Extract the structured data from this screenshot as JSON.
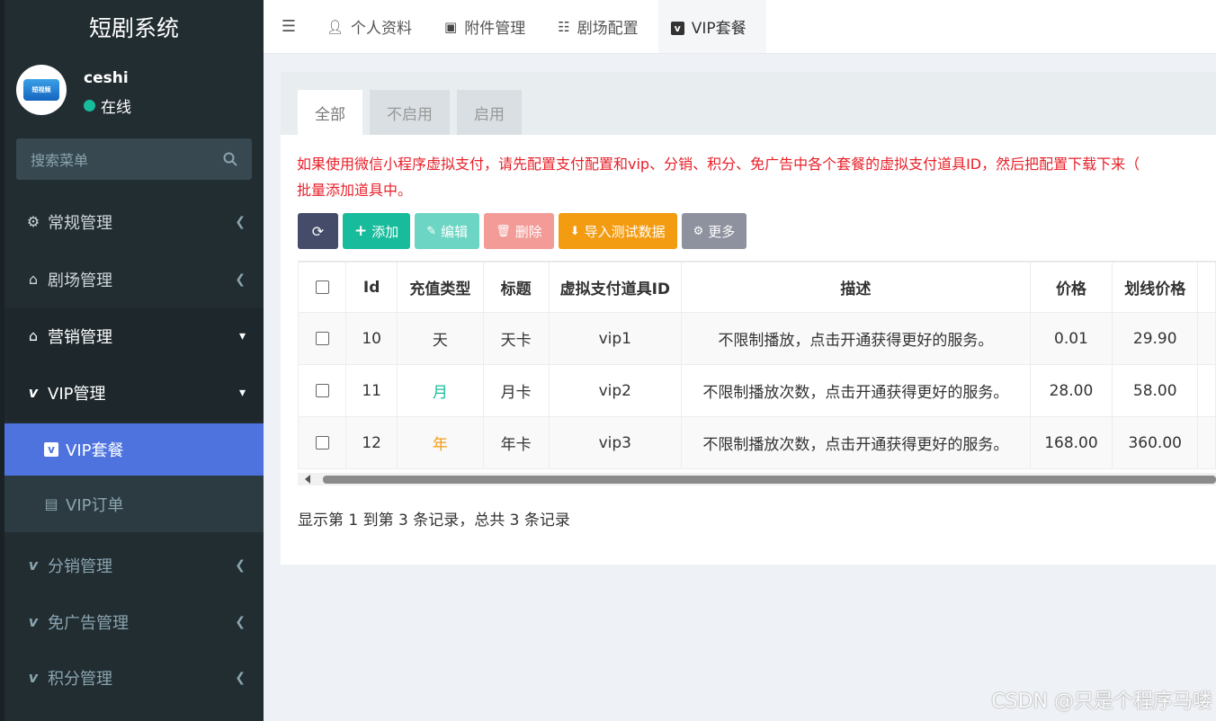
{
  "app": {
    "title": "短剧系统"
  },
  "user": {
    "name": "ceshi",
    "status": "在线",
    "avatar_text": "短视频"
  },
  "search": {
    "placeholder": "搜索菜单"
  },
  "sidebar": {
    "items": [
      {
        "label": "常规管理",
        "icon": "gears-icon"
      },
      {
        "label": "剧场管理",
        "icon": "home-icon"
      },
      {
        "label": "营销管理",
        "icon": "home-icon"
      },
      {
        "label": "VIP管理",
        "icon": "vimeo-icon"
      },
      {
        "label": "VIP套餐",
        "icon": "vimeo-square-icon"
      },
      {
        "label": "VIP订单",
        "icon": "file-icon"
      },
      {
        "label": "分销管理",
        "icon": "vimeo-icon"
      },
      {
        "label": "免广告管理",
        "icon": "vimeo-icon"
      },
      {
        "label": "积分管理",
        "icon": "vimeo-icon"
      }
    ]
  },
  "topbar": {
    "tabs": [
      {
        "label": "个人资料",
        "icon": "user-icon"
      },
      {
        "label": "附件管理",
        "icon": "image-icon"
      },
      {
        "label": "剧场配置",
        "icon": "sliders-icon"
      },
      {
        "label": "VIP套餐",
        "icon": "vimeo-square-icon"
      }
    ]
  },
  "filter_tabs": [
    "全部",
    "不启用",
    "启用"
  ],
  "notice": {
    "line1": "如果使用微信小程序虚拟支付，请先配置支付配置和vip、分销、积分、免广告中各个套餐的虚拟支付道具ID，然后把配置下载下来（",
    "line2": "批量添加道具中。"
  },
  "toolbar": {
    "add": "添加",
    "edit": "编辑",
    "delete": "删除",
    "import": "导入测试数据",
    "more": "更多"
  },
  "table": {
    "headers": [
      "Id",
      "充值类型",
      "标题",
      "虚拟支付道具ID",
      "描述",
      "价格",
      "划线价格"
    ],
    "rows": [
      {
        "id": "10",
        "type": "天",
        "title": "天卡",
        "prop_id": "vip1",
        "desc": "不限制播放，点击开通获得更好的服务。",
        "price": "0.01",
        "orig_price": "29.90"
      },
      {
        "id": "11",
        "type": "月",
        "title": "月卡",
        "prop_id": "vip2",
        "desc": "不限制播放次数，点击开通获得更好的服务。",
        "price": "28.00",
        "orig_price": "58.00"
      },
      {
        "id": "12",
        "type": "年",
        "title": "年卡",
        "prop_id": "vip3",
        "desc": "不限制播放次数，点击开通获得更好的服务。",
        "price": "168.00",
        "orig_price": "360.00"
      }
    ]
  },
  "pagination": {
    "text": "显示第 1 到第 3 条记录，总共 3 条记录"
  },
  "watermark": "CSDN @只是个程序马喽",
  "colors": {
    "sidebar_bg": "#222d32",
    "active_item": "#4e73df",
    "refresh_btn": "#444c69",
    "add_btn": "#18bc9c",
    "edit_btn": "#6dd5c3",
    "delete_btn": "#f29b97",
    "import_btn": "#f39c12",
    "more_btn": "#8e929e",
    "type_month": "#18bc9c",
    "type_year": "#f39c12",
    "notice_text": "#e8202a"
  }
}
